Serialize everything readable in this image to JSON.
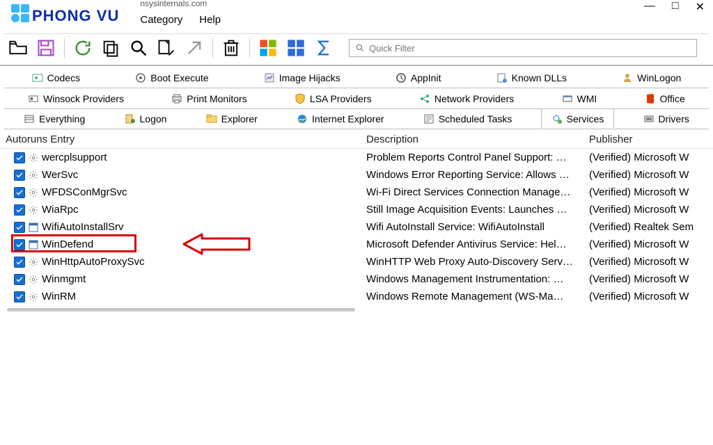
{
  "logo": {
    "text": "PHONG VU"
  },
  "subtitle_top": "nsysinternals.com",
  "menu": {
    "category": "Category",
    "help": "Help"
  },
  "window_controls": {
    "min": "—",
    "max": "□",
    "close": "✕"
  },
  "filter": {
    "placeholder": "Quick Filter"
  },
  "tab_rows": [
    [
      {
        "label": "Codecs"
      },
      {
        "label": "Boot Execute"
      },
      {
        "label": "Image Hijacks"
      },
      {
        "label": "AppInit"
      },
      {
        "label": "Known DLLs"
      },
      {
        "label": "WinLogon"
      }
    ],
    [
      {
        "label": "Winsock Providers"
      },
      {
        "label": "Print Monitors"
      },
      {
        "label": "LSA Providers"
      },
      {
        "label": "Network Providers"
      },
      {
        "label": "WMI"
      },
      {
        "label": "Office"
      }
    ],
    [
      {
        "label": "Everything"
      },
      {
        "label": "Logon"
      },
      {
        "label": "Explorer"
      },
      {
        "label": "Internet Explorer"
      },
      {
        "label": "Scheduled Tasks"
      },
      {
        "label": "Services",
        "active": true
      },
      {
        "label": "Drivers"
      }
    ]
  ],
  "columns": {
    "entry": "Autoruns Entry",
    "desc": "Description",
    "pub": "Publisher"
  },
  "rows": [
    {
      "name": "wercplsupport",
      "desc": "Problem Reports Control Panel Support: …",
      "pub": "(Verified) Microsoft W",
      "icon": "gear"
    },
    {
      "name": "WerSvc",
      "desc": "Windows Error Reporting Service: Allows …",
      "pub": "(Verified) Microsoft W",
      "icon": "gear"
    },
    {
      "name": "WFDSConMgrSvc",
      "desc": "Wi-Fi Direct Services Connection Manage…",
      "pub": "(Verified) Microsoft W",
      "icon": "gear"
    },
    {
      "name": "WiaRpc",
      "desc": "Still Image Acquisition Events: Launches …",
      "pub": "(Verified) Microsoft W",
      "icon": "gear"
    },
    {
      "name": "WifiAutoInstallSrv",
      "desc": "Wifi AutoInstall Service: WifiAutoInstall",
      "pub": "(Verified) Realtek Sem",
      "icon": "app"
    },
    {
      "name": "WinDefend",
      "desc": "Microsoft Defender Antivirus Service: Hel…",
      "pub": "(Verified) Microsoft W",
      "icon": "app",
      "highlight": true
    },
    {
      "name": "WinHttpAutoProxySvc",
      "desc": "WinHTTP Web Proxy Auto-Discovery Serv…",
      "pub": "(Verified) Microsoft W",
      "icon": "gear"
    },
    {
      "name": "Winmgmt",
      "desc": "Windows Management Instrumentation: …",
      "pub": "(Verified) Microsoft W",
      "icon": "gear"
    },
    {
      "name": "WinRM",
      "desc": "Windows Remote Management (WS-Ma…",
      "pub": "(Verified) Microsoft W",
      "icon": "gear"
    }
  ]
}
